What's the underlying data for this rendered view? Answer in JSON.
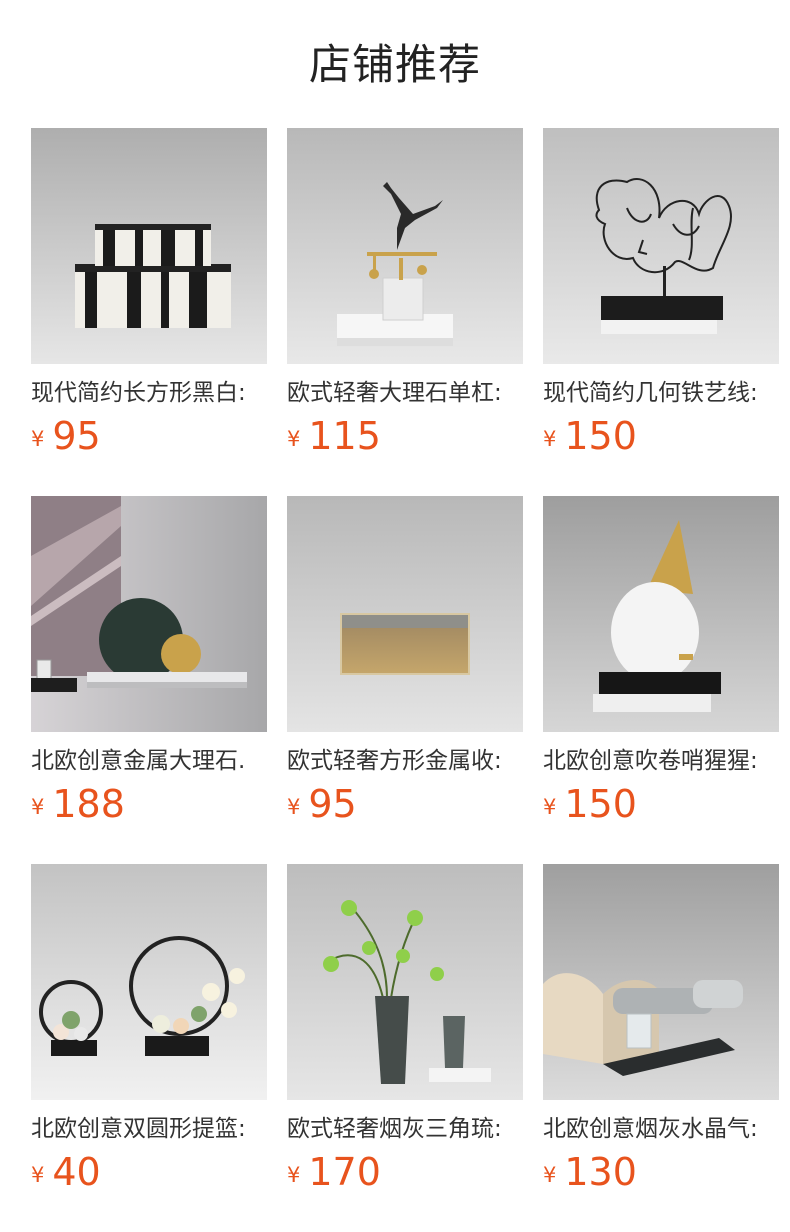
{
  "header": {
    "title": "店铺推荐"
  },
  "currency_symbol": "¥",
  "colors": {
    "price": "#e8531d",
    "title": "#222222",
    "name": "#333333"
  },
  "products": [
    {
      "name": "现代简约长方形黑白:",
      "price": "95",
      "image": "black-white-striped-boxes"
    },
    {
      "name": "欧式轻奢大理石单杠:",
      "price": "115",
      "image": "gymnast-sculpture-on-marble"
    },
    {
      "name": "现代简约几何铁艺线:",
      "price": "150",
      "image": "wire-face-art"
    },
    {
      "name": "北欧创意金属大理石.",
      "price": "188",
      "image": "marble-disc-ornament"
    },
    {
      "name": "欧式轻奢方形金属收:",
      "price": "95",
      "image": "gold-storage-box"
    },
    {
      "name": "北欧创意吹卷哨猩猩:",
      "price": "150",
      "image": "gorilla-party-hat-sculpture"
    },
    {
      "name": "北欧创意双圆形提篮:",
      "price": "40",
      "image": "ring-flower-baskets"
    },
    {
      "name": "欧式轻奢烟灰三角琉:",
      "price": "170",
      "image": "smoky-glass-vases"
    },
    {
      "name": "北欧创意烟灰水晶气:",
      "price": "130",
      "image": "crystal-bottle-ornament"
    }
  ]
}
